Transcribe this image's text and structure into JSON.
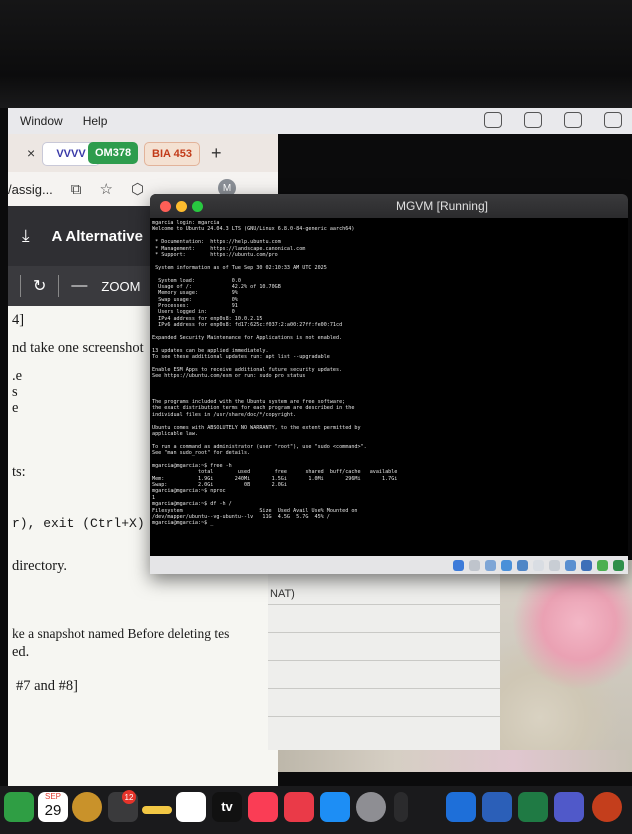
{
  "menubar": {
    "items": [
      "Window",
      "Help"
    ]
  },
  "browser": {
    "tabs": {
      "close": "×",
      "logo": "VVVV",
      "om": "OM378",
      "bia": "BIA 453",
      "new": "+"
    },
    "url": "/assig...",
    "avatar": "M",
    "pdf_toolbar": {
      "alt_label": "Alternative",
      "zoom_label": "ZOOM"
    },
    "doc_lines": [
      "4]",
      "nd take one screenshot",
      ".e",
      "s",
      "e",
      "ts:",
      "r), exit (Ctrl+X)",
      "directory.",
      "ke a snapshot named Before deleting tes",
      "ed.",
      "#7 and #8]"
    ]
  },
  "background_window": {
    "fragment": "NAT)"
  },
  "vm": {
    "title": "MGVM [Running]",
    "terminal_lines": [
      "mgarcia login: mgarcia",
      "Welcome to Ubuntu 24.04.3 LTS (GNU/Linux 6.8.0-84-generic aarch64)",
      "",
      " * Documentation:  https://help.ubuntu.com",
      " * Management:     https://landscape.canonical.com",
      " * Support:        https://ubuntu.com/pro",
      "",
      " System information as of Tue Sep 30 02:10:33 AM UTC 2025",
      "",
      "  System load:            0.0",
      "  Usage of /:             42.2% of 10.70GB",
      "  Memory usage:           9%",
      "  Swap usage:             0%",
      "  Processes:              91",
      "  Users logged in:        0",
      "  IPv4 address for enp0s8: 10.0.2.15",
      "  IPv6 address for enp0s8: fd17:625c:f037:2:a00:27ff:fe00:71cd",
      "",
      "Expanded Security Maintenance for Applications is not enabled.",
      "",
      "13 updates can be applied immediately.",
      "To see these additional updates run: apt list --upgradable",
      "",
      "Enable ESM Apps to receive additional future security updates.",
      "See https://ubuntu.com/esm or run: sudo pro status",
      "",
      "",
      "",
      "The programs included with the Ubuntu system are free software;",
      "the exact distribution terms for each program are described in the",
      "individual files in /usr/share/doc/*/copyright.",
      "",
      "Ubuntu comes with ABSOLUTELY NO WARRANTY, to the extent permitted by",
      "applicable law.",
      "",
      "To run a command as administrator (user \"root\"), use \"sudo <command>\".",
      "See \"man sudo_root\" for details.",
      "",
      "mgarcia@mgarcia:~$ free -h",
      "               total        used        free      shared  buff/cache   available",
      "Mem:           1.9Gi       240Mi       1.5Gi       1.0Mi       296Mi       1.7Gi",
      "Swap:          2.0Gi          0B       2.0Gi",
      "mgarcia@mgarcia:~$ nproc",
      "1",
      "mgarcia@mgarcia:~$ df -h /",
      "Filesystem                         Size  Used Avail Use% Mounted on",
      "/dev/mapper/ubuntu--vg-ubuntu--lv   11G  4.5G  5.7G  45% /",
      "mgarcia@mgarcia:~$ _"
    ]
  },
  "dock": {
    "calendar_month": "SEP",
    "calendar_day": "29",
    "mail_badge": "12",
    "tv_label": "tv"
  },
  "colors": {
    "om_tab": "#2e9c4d",
    "bia_tab_text": "#c23b19",
    "terminal_bg": "#000000",
    "traffic_red": "#ff5f57",
    "traffic_yellow": "#febc2e",
    "traffic_green": "#28c840"
  }
}
